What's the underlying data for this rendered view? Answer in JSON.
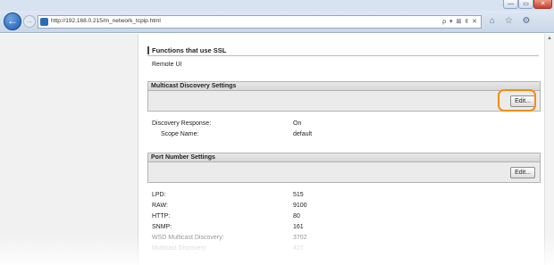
{
  "window": {
    "minimize_glyph": "—",
    "maximize_glyph": "▭",
    "close_glyph": "✕"
  },
  "browser": {
    "back_glyph": "←",
    "forward_glyph": "→",
    "url": "http://192.168.0.215/m_network_tcpip.html",
    "address_tools": "ρ ▾ ⊠ ¢ ✕",
    "toolbar_icons": "⌂ ☆ ⚙"
  },
  "ssl": {
    "heading": "Functions that use SSL",
    "item": "Remote UI"
  },
  "multicast": {
    "heading": "Multicast Discovery Settings",
    "edit_label": "Edit...",
    "rows": [
      {
        "label": "Discovery Response:",
        "value": "On"
      },
      {
        "label": "Scope Name:",
        "value": "default"
      }
    ]
  },
  "port": {
    "heading": "Port Number Settings",
    "edit_label": "Edit...",
    "rows": [
      {
        "label": "LPD:",
        "value": "515"
      },
      {
        "label": "RAW:",
        "value": "9100"
      },
      {
        "label": "HTTP:",
        "value": "80"
      },
      {
        "label": "SNMP:",
        "value": "161"
      },
      {
        "label": "WSD Multicast Discovery:",
        "value": "3702"
      },
      {
        "label": "Multicast Discovery:",
        "value": "427"
      }
    ]
  },
  "colors": {
    "highlight": "#f0900f",
    "section_header": "#d6d6d6"
  }
}
